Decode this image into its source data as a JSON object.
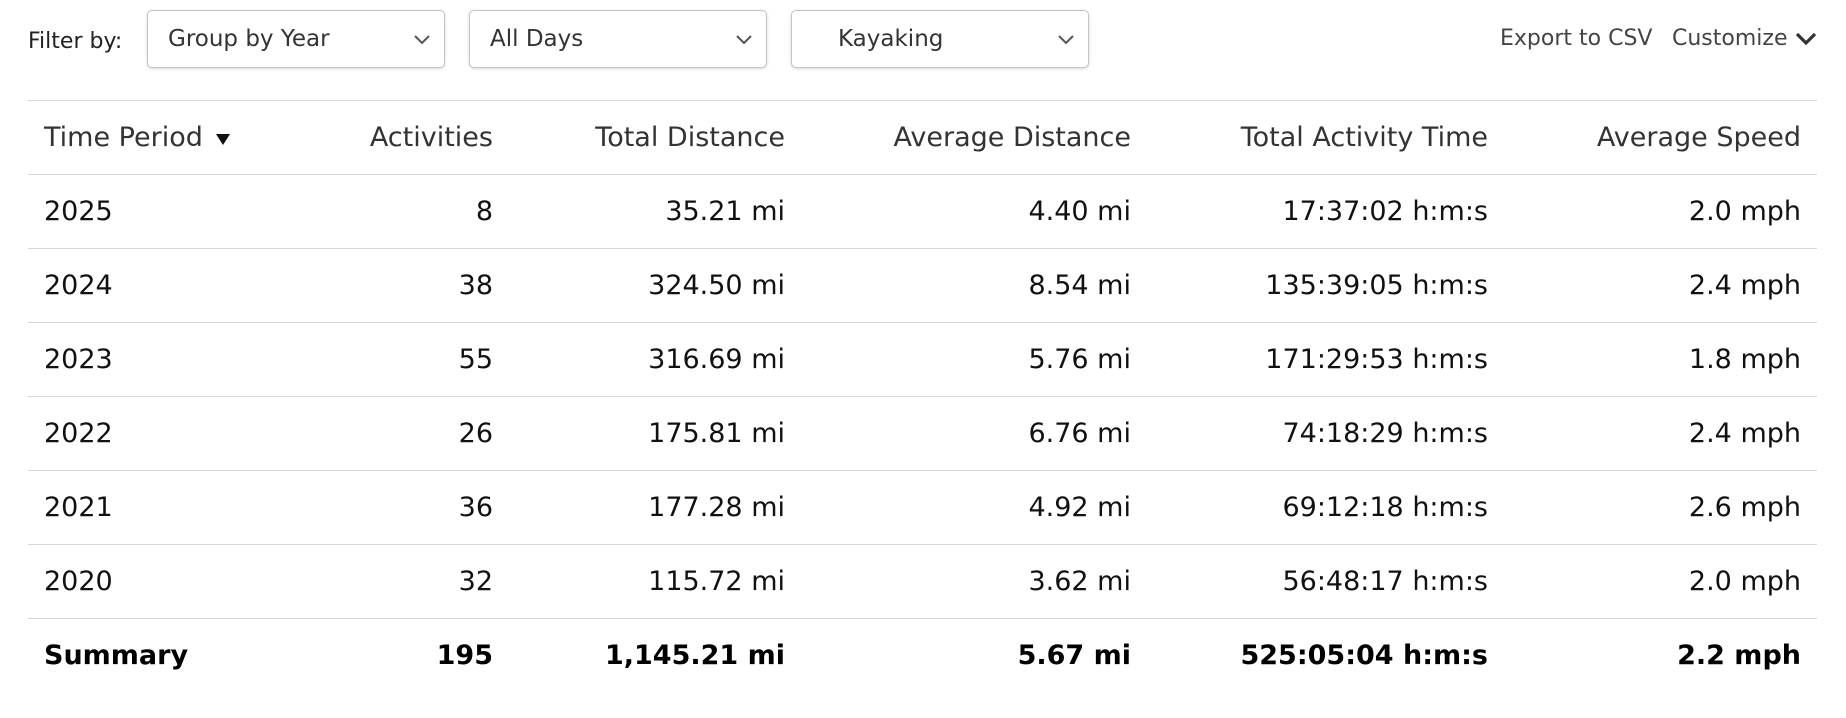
{
  "toolbar": {
    "filter_label": "Filter by:",
    "group_select": {
      "value": "Group by Year"
    },
    "days_select": {
      "value": "All Days"
    },
    "sport_select": {
      "value": "Kayaking"
    },
    "export_label": "Export to CSV",
    "customize_label": "Customize"
  },
  "table": {
    "headers": [
      "Time Period",
      "Activities",
      "Total Distance",
      "Average Distance",
      "Total Activity Time",
      "Average Speed"
    ],
    "sorted_column": "Time Period",
    "rows": [
      [
        "2025",
        "8",
        "35.21 mi",
        "4.40 mi",
        "17:37:02 h:m:s",
        "2.0 mph"
      ],
      [
        "2024",
        "38",
        "324.50 mi",
        "8.54 mi",
        "135:39:05 h:m:s",
        "2.4 mph"
      ],
      [
        "2023",
        "55",
        "316.69 mi",
        "5.76 mi",
        "171:29:53 h:m:s",
        "1.8 mph"
      ],
      [
        "2022",
        "26",
        "175.81 mi",
        "6.76 mi",
        "74:18:29 h:m:s",
        "2.4 mph"
      ],
      [
        "2021",
        "36",
        "177.28 mi",
        "4.92 mi",
        "69:12:18 h:m:s",
        "2.6 mph"
      ],
      [
        "2020",
        "32",
        "115.72 mi",
        "3.62 mi",
        "56:48:17 h:m:s",
        "2.0 mph"
      ]
    ],
    "summary": [
      "Summary",
      "195",
      "1,145.21 mi",
      "5.67 mi",
      "525:05:04 h:m:s",
      "2.2 mph"
    ]
  },
  "icons": {
    "select_chevron": "chevron-down-icon",
    "customize_chevron": "chevron-down-icon",
    "sort": "sort-descending-icon"
  },
  "colors": {
    "border": "#c4c4c4",
    "row_divider": "#d6d6d6",
    "text": "#111111",
    "link": "#444444"
  }
}
